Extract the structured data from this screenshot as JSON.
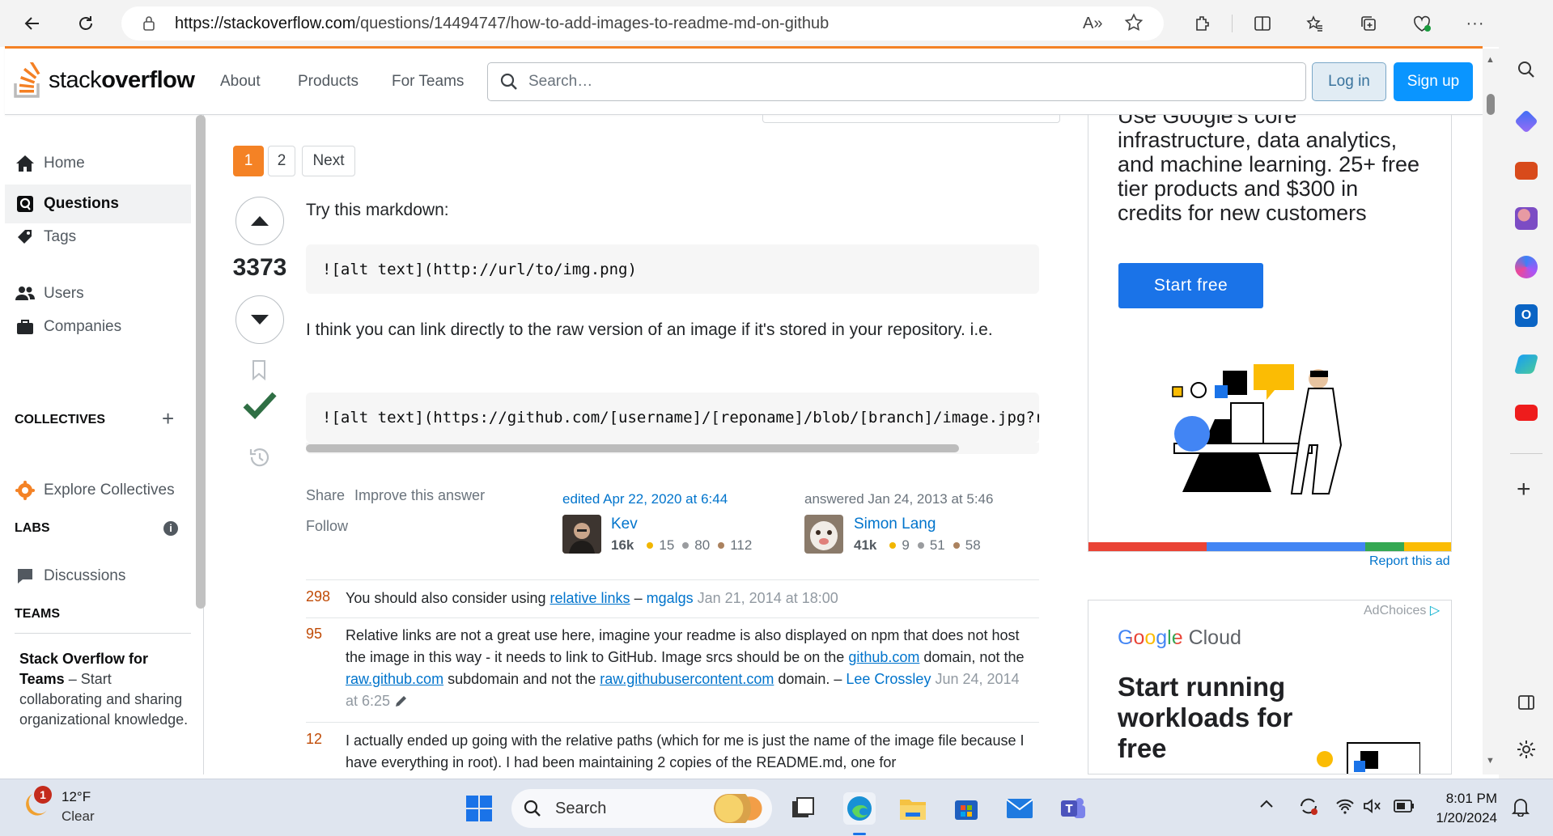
{
  "browser": {
    "url_host": "https://stackoverflow.com",
    "url_path": "/questions/14494747/how-to-add-images-to-readme-md-on-github"
  },
  "header": {
    "logo_light": "stack",
    "logo_bold": "overflow",
    "nav": [
      "About",
      "Products",
      "For Teams"
    ],
    "search_placeholder": "Search…",
    "login": "Log in",
    "signup": "Sign up"
  },
  "sidebar": {
    "items": [
      {
        "label": "Home",
        "icon": "home-icon"
      },
      {
        "label": "Questions",
        "icon": "questions-icon"
      },
      {
        "label": "Tags",
        "icon": "tag-icon"
      },
      {
        "label": "Users",
        "icon": "users-icon"
      },
      {
        "label": "Companies",
        "icon": "briefcase-icon"
      }
    ],
    "collectives_title": "COLLECTIVES",
    "explore_collectives": "Explore Collectives",
    "labs_title": "LABS",
    "discussions": "Discussions",
    "teams_title": "TEAMS",
    "teams_promo_bold": "Stack Overflow for Teams",
    "teams_promo_rest": " – Start collaborating and sharing organizational knowledge."
  },
  "pager": {
    "pages": [
      "1",
      "2"
    ],
    "next": "Next"
  },
  "answer": {
    "votes": "3373",
    "intro": "Try this markdown:",
    "code1": "![alt text](http://url/to/img.png)",
    "paragraph": "I think you can link directly to the raw version of an image if it's stored in your repository. i.e.",
    "code2": "![alt text](https://github.com/[username]/[reponame]/blob/[branch]/image.jpg?raw=true)",
    "share": "Share",
    "improve": "Improve this answer",
    "follow": "Follow",
    "edited_label": "edited Apr 22, 2020 at 6:44",
    "editor": {
      "name": "Kev",
      "rep": "16k",
      "gold": "15",
      "silver": "80",
      "bronze": "112"
    },
    "answered_label": "answered Jan 24, 2013 at 5:46",
    "author": {
      "name": "Simon Lang",
      "rep": "41k",
      "gold": "9",
      "silver": "51",
      "bronze": "58"
    }
  },
  "comments": [
    {
      "score": "298",
      "pre": "You should also consider using ",
      "link": "relative links",
      "post": " – ",
      "user": "mgalgs",
      "date": "Jan 21, 2014 at 18:00"
    },
    {
      "score": "95",
      "text1": "Relative links are not a great use here, imagine your readme is also displayed on npm that does not host the image in this way - it needs to link to GitHub. Image srcs should be on the ",
      "link1": "github.com",
      "text2": " domain, not the ",
      "link2": "raw.github.com",
      "text3": " subdomain and not the ",
      "link3": "raw.githubusercontent.com",
      "text4": " domain. – ",
      "user": "Lee Crossley",
      "date": "Jun 24, 2014 at 6:25"
    },
    {
      "score": "12",
      "text": "I actually ended up going with the relative paths (which for me is just the name of the image file because I have everything in root). I had been maintaining 2 copies of the README.md, one for"
    }
  ],
  "ad1": {
    "text_top": "Use Google's core",
    "text": "infrastructure, data analytics, and machine learning. 25+ free tier products and $300 in credits for new customers",
    "cta": "Start free",
    "report": "Report this ad"
  },
  "ad2": {
    "adchoices": "AdChoices",
    "brand_google": "Google",
    "brand_cloud": " Cloud",
    "headline": "Start running workloads for free"
  },
  "taskbar": {
    "weather_temp": "12°F",
    "weather_desc": "Clear",
    "weather_badge": "1",
    "search": "Search",
    "time": "8:01 PM",
    "date": "1/20/2024"
  }
}
